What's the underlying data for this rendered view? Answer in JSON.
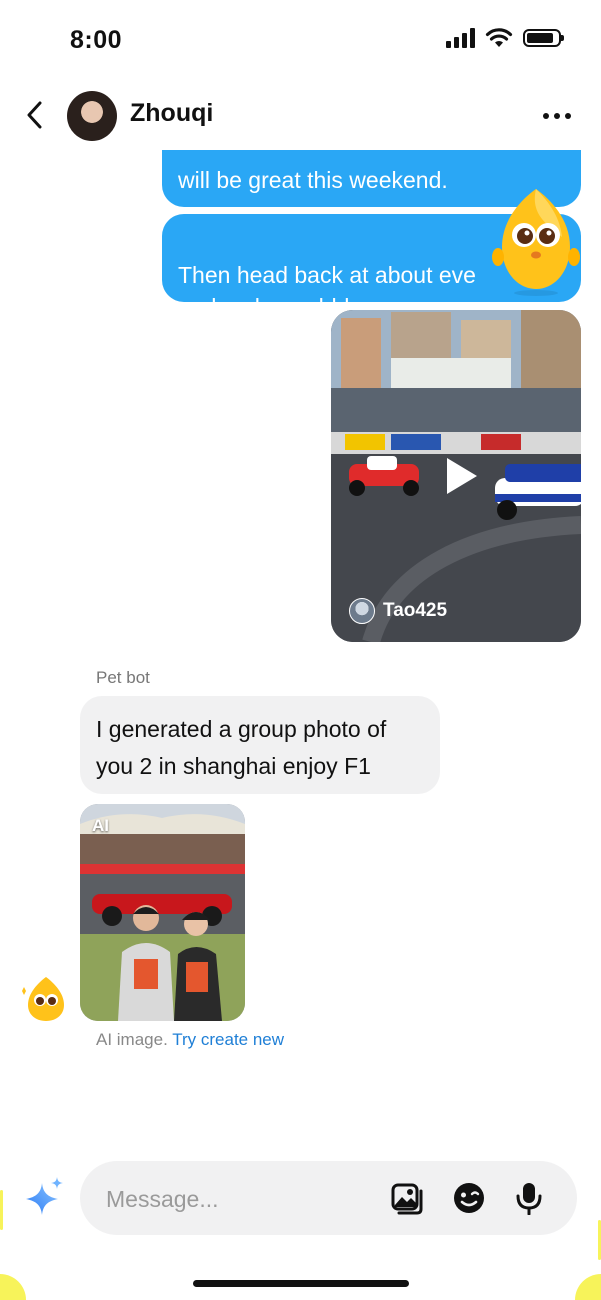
{
  "status_bar": {
    "time": "8:00"
  },
  "header": {
    "contact_name": "Zhouqi"
  },
  "messages": {
    "outgoing_1": "will be great this weekend.",
    "outgoing_2": "Then head back at about eve\nand go home hhh.",
    "video_card": {
      "username": "Tao425"
    },
    "bot_sender": "Pet bot",
    "incoming_1": "I generated a group photo of you 2 in shanghai enjoy F1",
    "ai_image": {
      "badge": "AI"
    },
    "ai_caption": {
      "text": "AI image.",
      "link": "Try create new"
    }
  },
  "composer": {
    "placeholder": "Message..."
  },
  "icons": {
    "back": "chevron-left-icon",
    "more": "more-horizontal-icon",
    "play": "play-icon",
    "sparkle": "sparkle-icon",
    "gallery": "image-gallery-icon",
    "sticker": "sticker-icon",
    "mic": "microphone-icon"
  },
  "colors": {
    "outgoing_bubble": "#2aa7f5",
    "incoming_bubble": "#f1f1f2",
    "link": "#1f7fd6",
    "mascot": "#ffb800",
    "frame_accent": "#f7f35a"
  }
}
